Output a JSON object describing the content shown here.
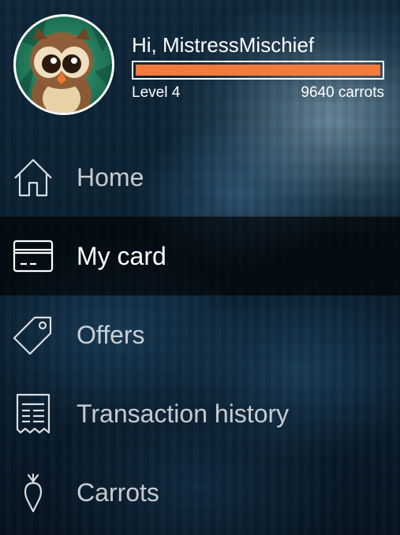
{
  "profile": {
    "greeting": "Hi, MistressMischief",
    "level": "Level 4",
    "carrots": "9640 carrots",
    "progress": 1.0,
    "progress_color": "#f47a3b",
    "avatar_icon": "owl-avatar-icon"
  },
  "menu": {
    "items": [
      {
        "label": "Home",
        "icon": "home-icon",
        "active": false
      },
      {
        "label": "My card",
        "icon": "card-icon",
        "active": true
      },
      {
        "label": "Offers",
        "icon": "tag-icon",
        "active": false
      },
      {
        "label": "Transaction history",
        "icon": "receipt-icon",
        "active": false
      },
      {
        "label": "Carrots",
        "icon": "carrot-icon",
        "active": false
      }
    ]
  }
}
